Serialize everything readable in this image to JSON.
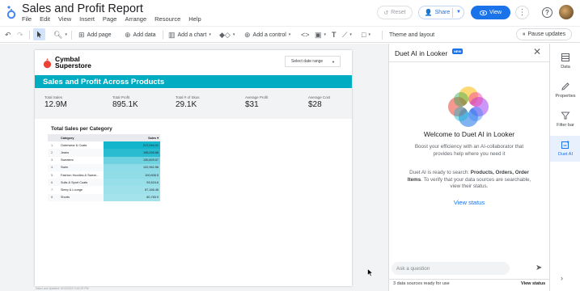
{
  "app": {
    "title": "Sales and Profit Report",
    "menu": [
      "File",
      "Edit",
      "View",
      "Insert",
      "Page",
      "Arrange",
      "Resource",
      "Help"
    ],
    "buttons": {
      "reset": "Reset",
      "share": "Share",
      "view": "View"
    }
  },
  "toolbar": {
    "add_page": "Add page",
    "add_data": "Add data",
    "add_chart": "Add a chart",
    "add_control": "Add a control",
    "theme": "Theme and layout",
    "pause": "Pause updates"
  },
  "report": {
    "brand_line1": "Cymbal",
    "brand_line2": "Superstore",
    "date_range": "Select date range",
    "banner": "Sales and Profit Across Products",
    "kpis": [
      {
        "label": "Total Sales",
        "value": "12.9M"
      },
      {
        "label": "Total Profit",
        "value": "895.1K"
      },
      {
        "label": "Total # of Skus",
        "value": "29.1K"
      },
      {
        "label": "Average Profit",
        "value": "$31"
      },
      {
        "label": "Average Cost",
        "value": "$28"
      }
    ],
    "table": {
      "title": "Total Sales per Category",
      "headers": {
        "category": "Category",
        "sales": "Sales ▾"
      },
      "rows": [
        {
          "n": "1.",
          "category": "Outerwear & Coats",
          "sales": "217,044.21",
          "level": 1.0
        },
        {
          "n": "2.",
          "category": "Jeans",
          "sales": "195,026.56",
          "level": 0.9
        },
        {
          "n": "3.",
          "category": "Sweaters",
          "sales": "130,829.07",
          "level": 0.6
        },
        {
          "n": "4.",
          "category": "Swim",
          "sales": "102,962.58",
          "level": 0.47
        },
        {
          "n": "5.",
          "category": "Fashion Hoodies & Sweat...",
          "sales": "100,606.5",
          "level": 0.46
        },
        {
          "n": "6.",
          "category": "Suits & Sport Coats",
          "sales": "93,524.6",
          "level": 0.43
        },
        {
          "n": "7.",
          "category": "Sleep & Lounge",
          "sales": "87,166.46",
          "level": 0.4
        },
        {
          "n": "8.",
          "category": "Shorts",
          "sales": "80,783.9",
          "level": 0.37
        }
      ]
    },
    "footer_note": "Data Last Updated: 6/13/2024 3:43:29 PM"
  },
  "panel": {
    "title": "Duet AI in Looker",
    "badge": "NEW",
    "welcome": "Welcome to Duet AI in Looker",
    "intro1": "Boost your efficiency with an AI-collaborator that provides help where you need it",
    "intro2_prefix": "Duet AI is ready to search: ",
    "intro2_bold": "Products, Orders, Order Items",
    "intro2_suffix": ". To verify that your data sources are searchable, view their status.",
    "view_status": "View status",
    "ask_placeholder": "Ask a question",
    "sources_ready": "3 data sources ready for use",
    "view_status_foot": "View status"
  },
  "rail": {
    "data": "Data",
    "properties": "Properties",
    "filter_bar": "Filter bar",
    "duet_ai": "Duet AI"
  },
  "colors": {
    "accent": "#1a73e8",
    "banner": "#00acc1",
    "heat_high": "#12b5cb",
    "heat_low": "#a5e3ec"
  }
}
